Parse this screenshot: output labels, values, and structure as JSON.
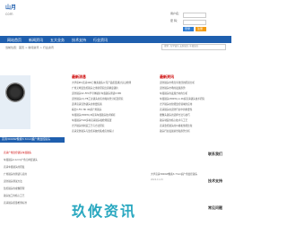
{
  "site": {
    "logo_text": "山月",
    "logo_sub": "com"
  },
  "login": {
    "user_label": "用户名：",
    "pass_label": "密 码：",
    "login_button": "登录",
    "register_button": "注册"
  },
  "nav": {
    "items": [
      "网站首页",
      "新闻资讯",
      "五大业务",
      "技术支持",
      "行业资讯"
    ]
  },
  "breadcrumb": "当前位置：首页 > 新闻资讯 > 行业资讯",
  "search": {
    "placeholder": "搜索: 光学镜头 安防镜头 车载镜头"
  },
  "latest_news": {
    "title": "最新消息",
    "items": [
      "大华获IPC高清400万像素镜头公司产品质量通过认证检测",
      "广角无畸变监控镜头之重新研究出高精度镜片",
      "安防镜头SC-FPC半导体镜片车载镜头测试CVPR",
      "安防镜头(C)-FB工业镜头的应用和前景分析及研究",
      "选择高清安防镜头的重要因素",
      "看出C-FIC 8K 4K超广角镜头",
      "车载镜头(800W)-B高清车载镜头技术解析",
      "车载镜头FLIR多种高清镜头和检测装置",
      "光学镜头的制造工艺与方法研究",
      "高清安防镜头与监控系统的集成应用探讨"
    ]
  },
  "recommend": {
    "title": "最新资讯",
    "items": [
      "安防镜头市场竞争激烈的原因分析",
      "安防镜头市场的发展趋势",
      "车载镜头的发展方向的分析",
      "车载镜头(800W)-A 4K超高清镜头技术研究",
      "光学镜头在智能监控领域的应用",
      "高清镜头在安防行业中的重要性",
      "摄像头镜头的选择方法与技巧",
      "镜头制造的核心技术与工艺",
      "高清监控镜头的价格和性能比较",
      "镜头行业发展前景和趋势分析"
    ]
  },
  "image_caption": "高清3000W像素3.7mm超广角监控镜头",
  "lower_left": {
    "items": [
      "高清广角监控镜头车载镜头",
      "车载镜头2.1mm广角无畸变镜头",
      "高清车载镜头的研发",
      "广角镜头的测试与应用",
      "安防镜头测试方法",
      "监控镜头的成像原理",
      "镜头加工的核心工艺",
      "高清镜头质量检测标准"
    ]
  },
  "lower_middle": {
    "item_text": "大华高清3000W像素3.7mm超广角监控镜头",
    "item_date": "2024-11-15"
  },
  "sidebar": {
    "title1": "联系我们",
    "title2": "技术支持",
    "title3": "常见问题"
  },
  "watermark": "玖攸资讯"
}
